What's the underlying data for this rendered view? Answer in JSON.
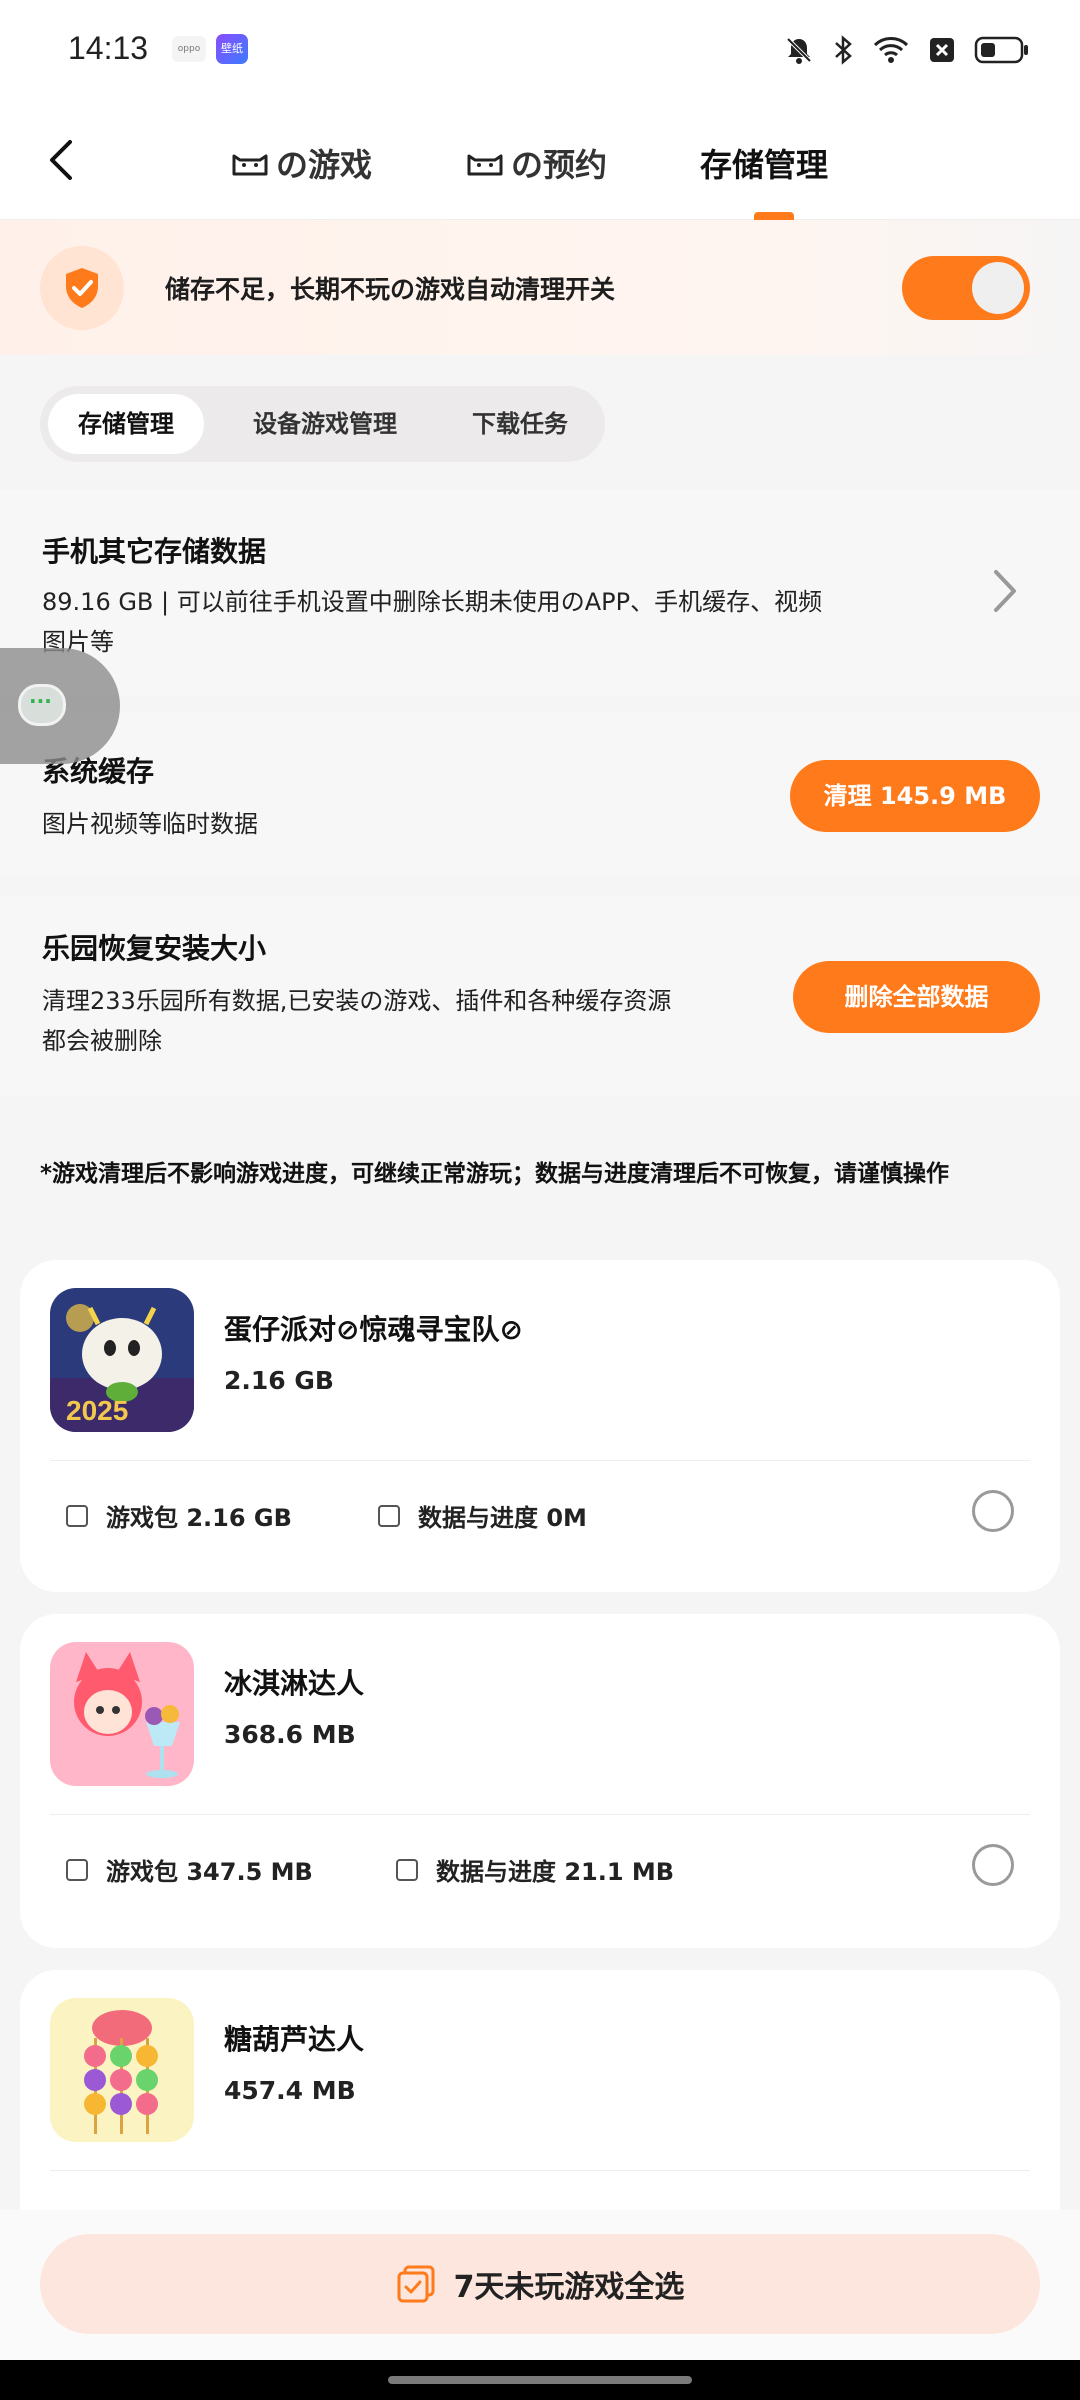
{
  "status_bar": {
    "time": "14:13",
    "app1": "oppo",
    "app2": "壁纸"
  },
  "nav": {
    "tabs": [
      {
        "label": "の游戏"
      },
      {
        "label": "の预约"
      },
      {
        "label": "存储管理",
        "active": true
      }
    ]
  },
  "banner": {
    "text": "储存不足，长期不玩の游戏自动清理开关",
    "toggle_on": true
  },
  "subtabs": [
    "存储管理",
    "设备游戏管理",
    "下载任务"
  ],
  "phone_storage": {
    "title": "手机其它存储数据",
    "desc_line1": "89.16 GB | 可以前往手机设置中删除长期未使用のAPP、手机缓存、视频",
    "desc_line2": "图片等"
  },
  "system_cache": {
    "title": "系统缓存",
    "desc": "图片视频等临时数据",
    "button": "清理 145.9 MB"
  },
  "park_restore": {
    "title": "乐园恢复安装大小",
    "desc_line1": "清理233乐园所有数据,已安装の游戏、插件和各种缓存资源",
    "desc_line2": "都会被删除",
    "button": "删除全部数据"
  },
  "warning": "*游戏清理后不影响游戏进度，可继续正常游玩；数据与进度清理后不可恢复，请谨慎操作",
  "games": [
    {
      "name": "蛋仔派对⊘惊魂寻宝队⊘",
      "size": "2.16 GB",
      "pkg": "游戏包 2.16 GB",
      "data": "数据与进度 0M"
    },
    {
      "name": "冰淇淋达人",
      "size": "368.6 MB",
      "pkg": "游戏包 347.5 MB",
      "data": "数据与进度 21.1 MB"
    },
    {
      "name": "糖葫芦达人",
      "size": "457.4 MB"
    }
  ],
  "bottom": {
    "select_all": "7天未玩游戏全选"
  },
  "colors": {
    "accent": "#ff7a1a",
    "banner_bg": "#fff1ea",
    "select_all_bg": "#fde6de"
  }
}
